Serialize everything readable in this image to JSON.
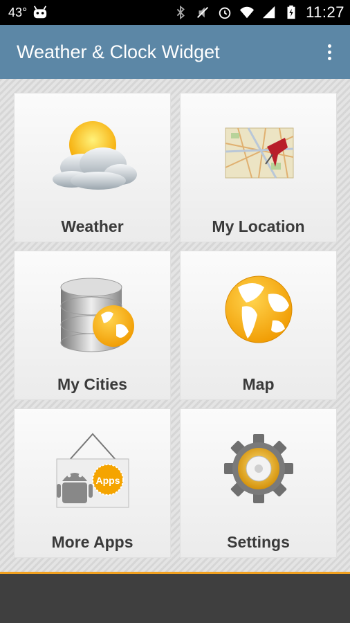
{
  "status_bar": {
    "temperature": "43°",
    "time": "11:27",
    "icons": [
      "android-notification-icon",
      "bluetooth-icon",
      "mute-icon",
      "alarm-icon",
      "wifi-icon",
      "signal-icon",
      "battery-icon"
    ]
  },
  "app_bar": {
    "title": "Weather & Clock Widget",
    "menu_icon": "overflow-menu-icon",
    "color": "#5c87a6"
  },
  "tiles": [
    {
      "label": "Weather",
      "icon": "weather-icon"
    },
    {
      "label": "My Location",
      "icon": "map-pin-icon"
    },
    {
      "label": "My Cities",
      "icon": "database-globe-icon"
    },
    {
      "label": "Map",
      "icon": "globe-icon"
    },
    {
      "label": "More Apps",
      "icon": "more-apps-icon",
      "badge": "Apps"
    },
    {
      "label": "Settings",
      "icon": "gear-icon"
    }
  ],
  "accent_color": "#f0a020"
}
